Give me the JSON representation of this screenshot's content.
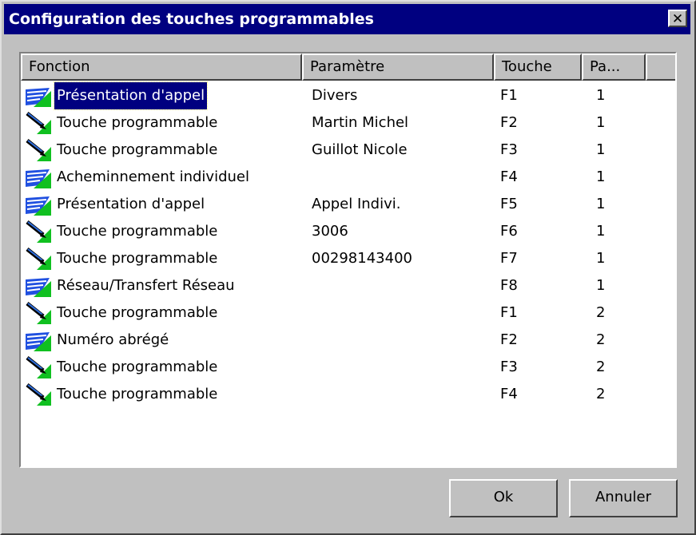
{
  "window": {
    "title": "Configuration des touches programmables",
    "close_label": "✕"
  },
  "list": {
    "columns": [
      {
        "label": "Fonction"
      },
      {
        "label": "Paramètre"
      },
      {
        "label": "Touche"
      },
      {
        "label": "Pa..."
      }
    ],
    "rows": [
      {
        "icon": "network-icon",
        "fonction": "Présentation d'appel",
        "parametre": "Divers",
        "touche": "F1",
        "page": "1",
        "selected": true
      },
      {
        "icon": "pen-icon",
        "fonction": "Touche programmable",
        "parametre": "Martin Michel",
        "touche": "F2",
        "page": "1"
      },
      {
        "icon": "pen-icon",
        "fonction": "Touche programmable",
        "parametre": "Guillot Nicole",
        "touche": "F3",
        "page": "1"
      },
      {
        "icon": "network-icon",
        "fonction": "Acheminnement individuel",
        "parametre": "",
        "touche": "F4",
        "page": "1"
      },
      {
        "icon": "network-icon",
        "fonction": "Présentation d'appel",
        "parametre": "Appel Indivi.",
        "touche": "F5",
        "page": "1"
      },
      {
        "icon": "pen-icon",
        "fonction": "Touche programmable",
        "parametre": "3006",
        "touche": "F6",
        "page": "1"
      },
      {
        "icon": "pen-icon",
        "fonction": "Touche programmable",
        "parametre": "00298143400",
        "touche": "F7",
        "page": "1"
      },
      {
        "icon": "network-icon",
        "fonction": "Réseau/Transfert Réseau",
        "parametre": "",
        "touche": "F8",
        "page": "1"
      },
      {
        "icon": "pen-icon",
        "fonction": "Touche programmable",
        "parametre": "",
        "touche": "F1",
        "page": "2"
      },
      {
        "icon": "network-icon",
        "fonction": "Numéro abrégé",
        "parametre": "",
        "touche": "F2",
        "page": "2"
      },
      {
        "icon": "pen-icon",
        "fonction": "Touche programmable",
        "parametre": "",
        "touche": "F3",
        "page": "2"
      },
      {
        "icon": "pen-icon",
        "fonction": "Touche programmable",
        "parametre": "",
        "touche": "F4",
        "page": "2"
      }
    ]
  },
  "buttons": {
    "ok_label": "Ok",
    "cancel_label": "Annuler"
  }
}
